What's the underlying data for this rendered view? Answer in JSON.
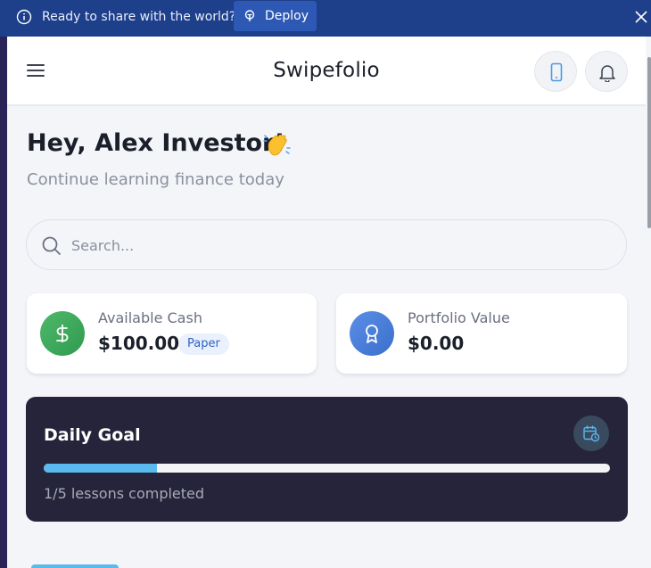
{
  "banner": {
    "message": "Ready to share with the world?",
    "deploy_label": "Deploy"
  },
  "header": {
    "title": "Swipefolio"
  },
  "greeting": {
    "title": "Hey, Alex Investor!",
    "emoji": "👋",
    "subtitle": "Continue learning finance today"
  },
  "search": {
    "placeholder": "Search...",
    "value": ""
  },
  "stats": {
    "cash": {
      "label": "Available Cash",
      "value": "$100.00",
      "badge": "Paper",
      "icon": "dollar-icon"
    },
    "portfolio": {
      "label": "Portfolio Value",
      "value": "$0.00",
      "icon": "award-icon"
    }
  },
  "daily_goal": {
    "title": "Daily Goal",
    "progress_text": "1/5 lessons completed",
    "completed": 1,
    "total": 5,
    "icon": "calendar-clock-icon"
  },
  "colors": {
    "banner": "#1e3f8a",
    "accent": "#5ab9ef",
    "goal_card": "#26243a",
    "cash_icon": "#3fa95c",
    "portfolio_icon": "#4a7fd8"
  }
}
